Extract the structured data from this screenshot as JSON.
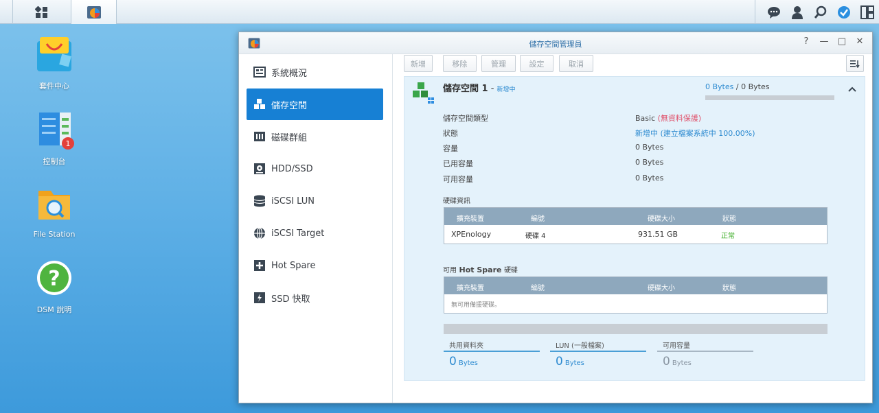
{
  "window": {
    "title": "儲存空間管理員",
    "controls": [
      "?",
      "—",
      "□",
      "✕"
    ]
  },
  "desktop": {
    "icons": [
      {
        "label": "套件中心",
        "icon": "package-center-icon"
      },
      {
        "label": "控制台",
        "icon": "control-panel-icon",
        "badge": "1"
      },
      {
        "label": "File Station",
        "icon": "file-station-icon"
      },
      {
        "label": "DSM 說明",
        "icon": "help-icon"
      }
    ]
  },
  "sidebar": {
    "items": [
      {
        "label": "系統概況",
        "icon": "overview-icon"
      },
      {
        "label": "儲存空間",
        "icon": "volume-icon",
        "active": true
      },
      {
        "label": "磁碟群組",
        "icon": "disk-group-icon"
      },
      {
        "label": "HDD/SSD",
        "icon": "hdd-icon"
      },
      {
        "label": "iSCSI LUN",
        "icon": "iscsi-lun-icon"
      },
      {
        "label": "iSCSI Target",
        "icon": "iscsi-target-icon"
      },
      {
        "label": "Hot Spare",
        "icon": "hot-spare-icon"
      },
      {
        "label": "SSD 快取",
        "icon": "ssd-cache-icon"
      }
    ]
  },
  "toolbar": {
    "create": "新增",
    "remove": "移除",
    "manage": "管理",
    "settings": "設定",
    "cancel": "取消"
  },
  "volume": {
    "name": "儲存空間 1",
    "status_short": "新增中",
    "usage": "0 Bytes",
    "capacity": "0 Bytes",
    "usage_fraction": 0,
    "details": {
      "type_label": "儲存空間類型",
      "type_value": "Basic",
      "type_note": "(無資料保護)",
      "status_label": "狀態",
      "status_value": "新增中",
      "status_note": "(建立檔案系統中",
      "status_percent": "100.00%)",
      "capacity_label": "容量",
      "capacity_value": "0 Bytes",
      "used_label": "已用容量",
      "used_value": "0 Bytes",
      "free_label": "可用容量",
      "free_value": "0 Bytes"
    },
    "disk_info_title": "硬碟資訊",
    "disk_table": {
      "headers": [
        "擴充裝置",
        "編號",
        "硬碟大小",
        "狀態"
      ],
      "rows": [
        {
          "device": "XPEnology",
          "number": "硬碟 4",
          "size": "931.51 GB",
          "status": "正常"
        }
      ]
    },
    "hotspare_title_prefix": "可用",
    "hotspare_title_bold": "Hot Spare",
    "hotspare_title_suffix": "硬碟",
    "hotspare_table": {
      "headers": [
        "擴充裝置",
        "編號",
        "硬碟大小",
        "狀態"
      ],
      "empty": "無可用備援硬碟。"
    },
    "stats": [
      {
        "label": "共用資料夾",
        "value": "0",
        "unit": "Bytes"
      },
      {
        "label": "LUN (一般檔案)",
        "value": "0",
        "unit": "Bytes"
      },
      {
        "label": "可用容量",
        "value": "0",
        "unit": "Bytes"
      }
    ]
  },
  "colors": {
    "accent": "#1780d4",
    "link": "#2c8ad0",
    "warning": "#e0506a",
    "ok": "#3fae2a"
  }
}
